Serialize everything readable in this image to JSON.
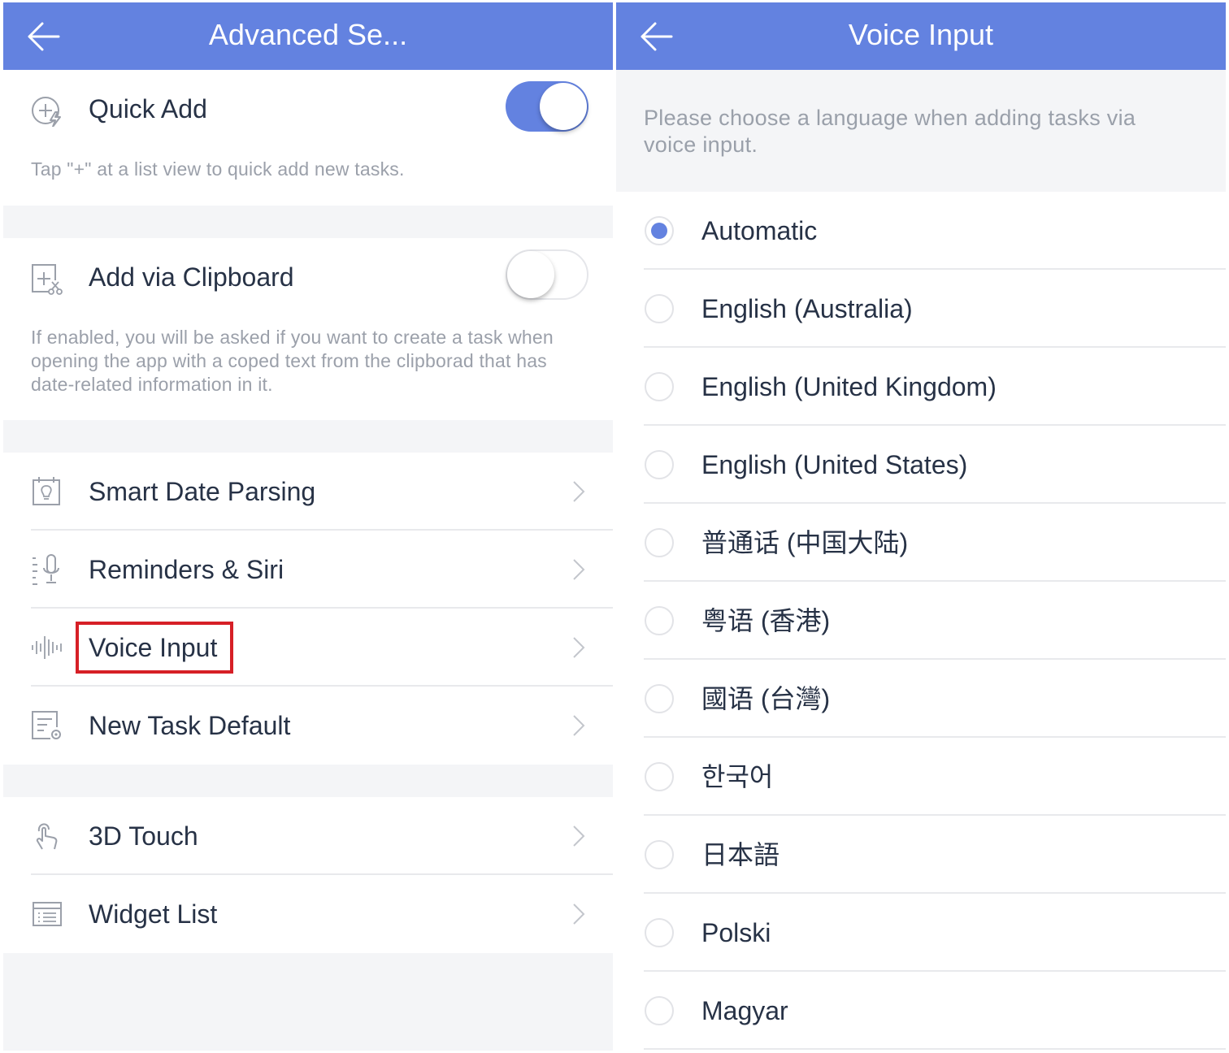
{
  "colors": {
    "accent": "#6382e0",
    "highlight": "#d61f26",
    "text": "#273246",
    "muted": "#9ba0aa"
  },
  "left": {
    "title": "Advanced Se...",
    "quick_add": {
      "label": "Quick Add",
      "enabled": true,
      "desc": "Tap \"+\" at a list view to quick add new tasks.",
      "icon": "quick-add-icon"
    },
    "clipboard": {
      "label": "Add via Clipboard",
      "enabled": false,
      "desc": "If enabled, you will be asked if you want to create a task when opening the app with a coped text from the clipborad that has date-related information in it.",
      "icon": "clipboard-add-icon"
    },
    "items": [
      {
        "label": "Smart Date Parsing",
        "icon": "calendar-bulb-icon"
      },
      {
        "label": "Reminders & Siri",
        "icon": "microphone-icon"
      },
      {
        "label": "Voice Input",
        "icon": "sound-wave-icon"
      },
      {
        "label": "New Task Default",
        "icon": "task-settings-icon"
      }
    ],
    "items2": [
      {
        "label": "3D Touch",
        "icon": "touch-icon"
      },
      {
        "label": "Widget List",
        "icon": "widget-list-icon"
      }
    ]
  },
  "right": {
    "title": "Voice Input",
    "intro": "Please choose a language when adding tasks via voice input.",
    "selected": "Automatic",
    "languages": [
      "Automatic",
      "English (Australia)",
      "English (United Kingdom)",
      "English (United States)",
      "普通话 (中国大陆)",
      "粤语 (香港)",
      "國语 (台灣)",
      "한국어",
      "日本語",
      "Polski",
      "Magyar"
    ]
  }
}
